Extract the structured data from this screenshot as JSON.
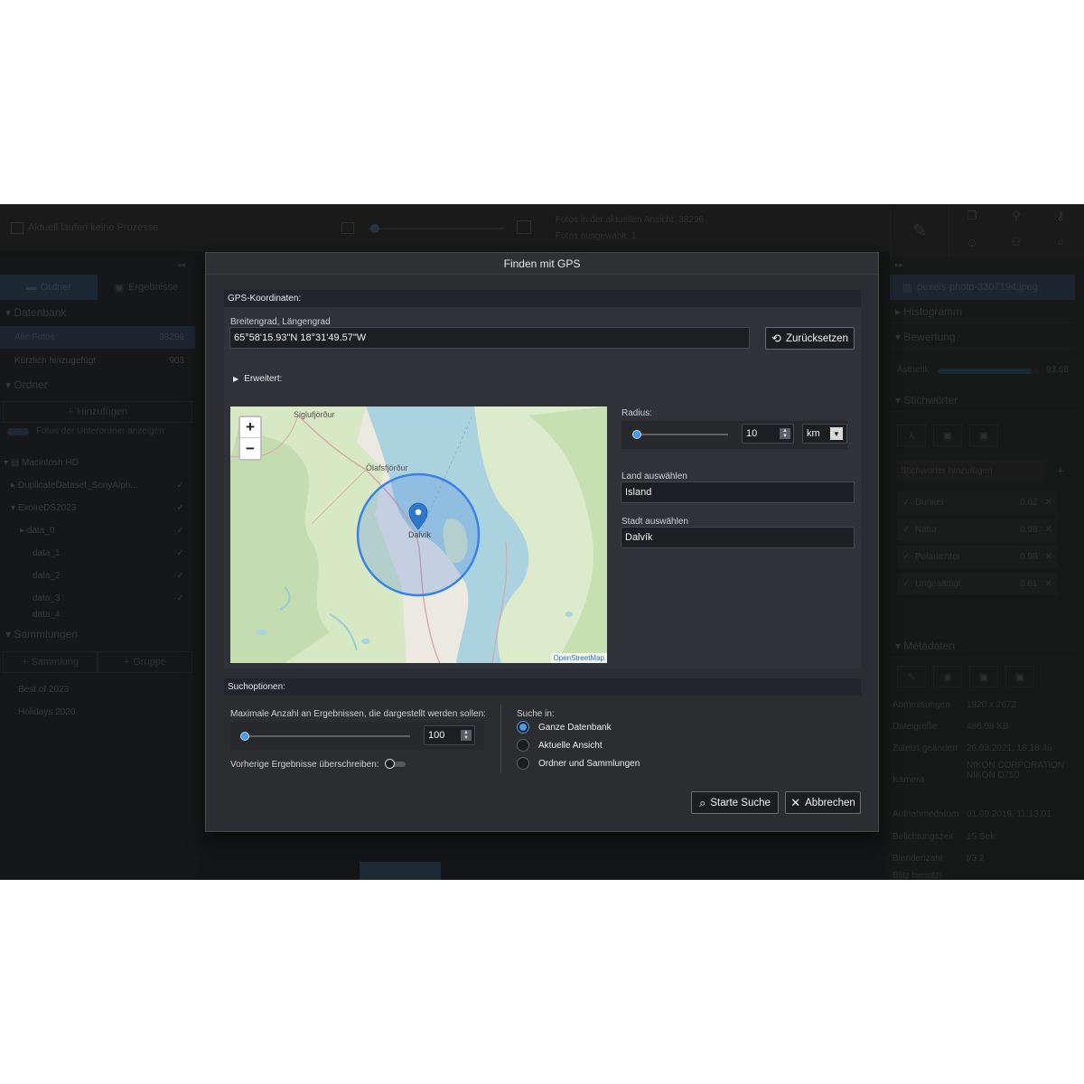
{
  "background_app": {
    "status": "Aktuell laufen keine Prozesse",
    "photos_in_view": "Fotos in der aktuellen Ansicht: 38296",
    "photos_selected": "Fotos ausgewählt: 1",
    "tabs": {
      "folders": "Ordner",
      "results": "Ergebnisse"
    },
    "database": {
      "heading": "Datenbank",
      "items": [
        {
          "label": "Alle Fotos",
          "count": "38296"
        },
        {
          "label": "Kürzlich hinzugefügt",
          "count": "903"
        }
      ]
    },
    "folders": {
      "heading": "Ordner",
      "add_label": "Hinzufügen",
      "show_subfolders": "Fotos der Unterordner anzeigen",
      "tree": [
        "Macintosh HD",
        "DuplicateDataset_SonyAlph...",
        "ExoireDS2023",
        "data_0",
        "data_1",
        "data_2",
        "data_3",
        "data_4"
      ]
    },
    "collections": {
      "heading": "Sammlungen",
      "add_collection": "Sammlung",
      "add_group": "Gruppe",
      "items": [
        "Best of 2023",
        "Holidays 2020"
      ]
    },
    "right": {
      "filename": "pexels-photo-3307194.jpeg",
      "histogram": "Histogramm",
      "rating": "Bewertung",
      "aesthetics_label": "Ästhetik",
      "aesthetics_value": "93.68",
      "aesthetics_fraction": 0.93,
      "keywords": "Stichwörter",
      "keyword_placeholder": "Stichwörter hinzufügen",
      "tags": [
        {
          "label": "Dunkel",
          "score": "0.62"
        },
        {
          "label": "Natur",
          "score": "0.98"
        },
        {
          "label": "Polarlichter",
          "score": "0.98"
        },
        {
          "label": "Ungesättigt",
          "score": "0.61"
        }
      ],
      "metadata": "Metadaten",
      "meta_rows": [
        {
          "k": "Abmessungen",
          "v": "1920 x 2672"
        },
        {
          "k": "Dateigröße",
          "v": "486.98 KB"
        },
        {
          "k": "Zuletzt geändert",
          "v": "26.03.2021, 18:18:46"
        },
        {
          "k": "Kamera",
          "v": "NIKON CORPORATION NIKON D750"
        },
        {
          "k": "Aufnahmedatum",
          "v": "01.09.2019, 11:13:01"
        },
        {
          "k": "Belichtungszeit",
          "v": "15 Sek."
        },
        {
          "k": "Blendenzahl",
          "v": "f/3.2"
        },
        {
          "k": "Blitz benutzt",
          "v": ""
        }
      ]
    }
  },
  "dialog": {
    "title": "Finden mit GPS",
    "gps_group": "GPS-Koordinaten:",
    "coord_label": "Breitengrad, Längengrad",
    "coord_value": "65°58'15.93\"N 18°31'49.57\"W",
    "reset_button": "Zurücksetzen",
    "advanced": "Erweitert:",
    "map": {
      "zoom_in": "+",
      "zoom_out": "−",
      "places": [
        "Siglufjörður",
        "Ólafsfjörður",
        "Dalvík"
      ],
      "attribution": "OpenStreetMap"
    },
    "radius_label": "Radius:",
    "radius_value": "10",
    "radius_unit": "km",
    "radius_fraction": 0.0,
    "country_label": "Land auswählen",
    "country_value": "Island",
    "city_label": "Stadt auswählen",
    "city_value": "Dalvík",
    "search_options_group": "Suchoptionen:",
    "max_results_label": "Maximale Anzahl an Ergebnissen, die dargestellt werden sollen:",
    "max_results_value": "100",
    "overwrite_label": "Vorherige Ergebnisse überschreiben:",
    "overwrite_on": false,
    "search_in_label": "Suche in:",
    "search_in_options": [
      "Ganze Datenbank",
      "Aktuelle Ansicht",
      "Ordner und Sammlungen"
    ],
    "search_in_selected": 0,
    "start_button": "Starte Suche",
    "cancel_button": "Abbrechen"
  },
  "colors": {
    "accent": "#4a9ae8",
    "dialog_bg": "#2b2d30",
    "app_bg": "#232425"
  }
}
